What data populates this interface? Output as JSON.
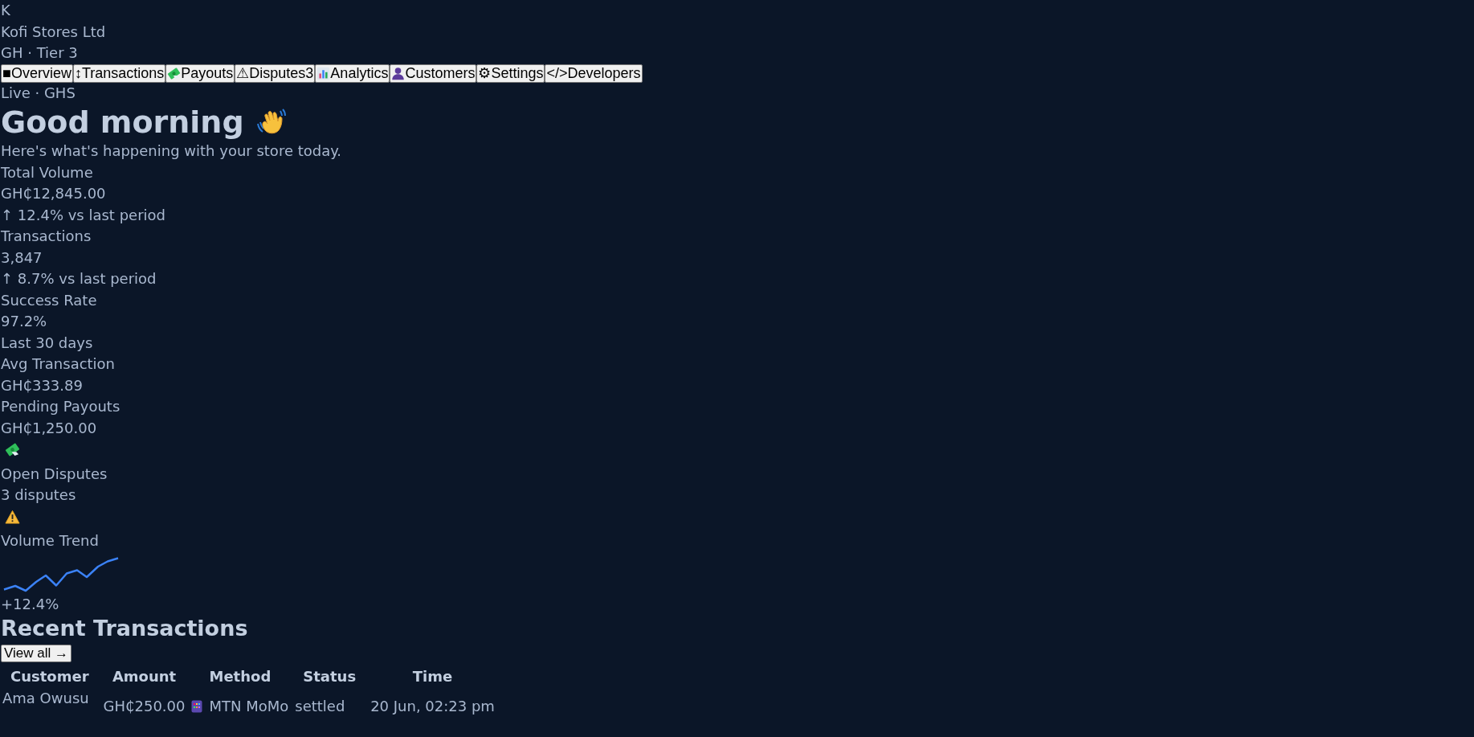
{
  "brand": {
    "initial": "K",
    "name": "Kofi Stores Ltd",
    "meta": "GH · Tier 3"
  },
  "nav": [
    {
      "label": "Overview",
      "glyph": "■"
    },
    {
      "label": "Transactions",
      "glyph": "↕"
    },
    {
      "label": "Payouts",
      "kind": "money"
    },
    {
      "label": "Disputes",
      "glyph": "⚠",
      "badge": "3"
    },
    {
      "label": "Analytics",
      "kind": "chart"
    },
    {
      "label": "Customers",
      "kind": "person"
    },
    {
      "label": "Settings",
      "glyph": "⚙"
    },
    {
      "label": "Developers",
      "glyph": "</>"
    }
  ],
  "mode": "Live · GHS",
  "greeting": {
    "title": "Good morning",
    "subtitle": "Here's what's happening with your store today."
  },
  "stats": [
    {
      "label": "Total Volume",
      "value": "GH₵12,845.00",
      "note": "↑ 12.4% vs last period"
    },
    {
      "label": "Transactions",
      "value": "3,847",
      "note": "↑ 8.7% vs last period"
    },
    {
      "label": "Success Rate",
      "value": "97.2%",
      "note": "Last 30 days"
    },
    {
      "label": "Avg Transaction",
      "value": "GH₵333.89"
    },
    {
      "label": "Pending Payouts",
      "value": "GH₵1,250.00",
      "kind": "money"
    },
    {
      "label": "Open Disputes",
      "value": "3 disputes",
      "kind": "warning"
    }
  ],
  "trend": {
    "title": "Volume Trend",
    "change": "+12.4%"
  },
  "recent": {
    "title": "Recent Transactions",
    "view_all": "View all →",
    "columns": [
      "Customer",
      "Amount",
      "Method",
      "Status",
      "Time"
    ],
    "rows": [
      {
        "customer": "Ama Owusu",
        "amount": "GH₵250.00",
        "method": "MTN MoMo",
        "status": "settled",
        "time": "20 Jun, 02:23 pm"
      }
    ]
  }
}
